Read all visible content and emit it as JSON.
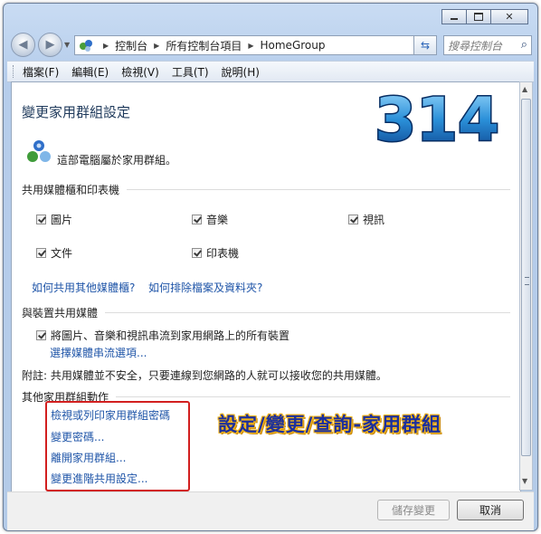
{
  "window": {
    "minimize_icon": "minimize-icon",
    "maximize_icon": "maximize-icon",
    "close_icon": "close-icon"
  },
  "nav": {
    "back_icon": "back-arrow-icon",
    "forward_icon": "forward-arrow-icon",
    "breadcrumb": [
      "控制台",
      "所有控制台項目",
      "HomeGroup"
    ],
    "search_placeholder": "搜尋控制台"
  },
  "menu": [
    "檔案(F)",
    "編輯(E)",
    "檢視(V)",
    "工具(T)",
    "說明(H)"
  ],
  "main": {
    "title": "變更家用群組設定",
    "status": "這部電腦屬於家用群組。",
    "shared_section": "共用媒體櫃和印表機",
    "share_items": [
      "圖片",
      "音樂",
      "視訊",
      "文件",
      "印表機"
    ],
    "link_other_libraries": "如何共用其他媒體櫃?",
    "link_exclude": "如何排除檔案及資料夾?",
    "device_section": "與裝置共用媒體",
    "stream_checkbox": "將圖片、音樂和視訊串流到家用網路上的所有裝置",
    "stream_options_link": "選擇媒體串流選項...",
    "note": "附註: 共用媒體並不安全，只要連線到您網路的人就可以接收您的共用媒體。",
    "other_section": "其他家用群組動作",
    "actions": [
      "檢視或列印家用群組密碼",
      "變更密碼...",
      "離開家用群組...",
      "變更進階共用設定..."
    ]
  },
  "annotation": {
    "number": "314",
    "text": "設定/變更/查詢-家用群組",
    "text_color": "#1c2f9c",
    "highlight_color": "#d21f1f"
  },
  "footer": {
    "save": "儲存變更",
    "cancel": "取消"
  }
}
